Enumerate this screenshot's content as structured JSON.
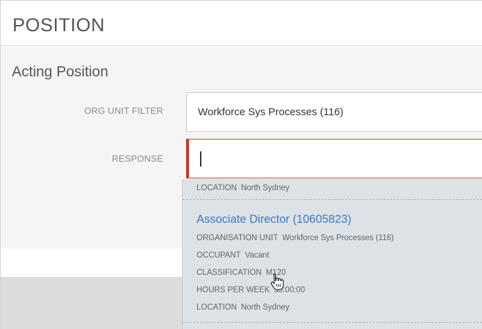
{
  "header": {
    "title": "POSITION"
  },
  "section": {
    "title": "Acting Position"
  },
  "fields": {
    "org_unit_filter": {
      "label": "ORG UNIT FILTER",
      "value": "Workforce Sys Processes (116)"
    },
    "response": {
      "label": "RESPONSE",
      "value": ""
    }
  },
  "dropdown": {
    "previous_option": {
      "location_key": "LOCATION",
      "location_value": "North Sydney"
    },
    "option": {
      "title": "Associate Director (10605823)",
      "details": [
        {
          "key": "ORGANISATION UNIT",
          "value": "Workforce Sys Processes (116)"
        },
        {
          "key": "OCCUPANT",
          "value": "Vacant"
        },
        {
          "key": "CLASSIFICATION",
          "value": "M120"
        },
        {
          "key": "HOURS PER WEEK",
          "value": "35:00:00"
        },
        {
          "key": "LOCATION",
          "value": "North Sydney"
        }
      ]
    }
  },
  "cursor": {
    "icon": "hand-pointer-icon"
  },
  "colors": {
    "accent_error": "#c0391b",
    "link": "#3e7bbf",
    "dropdown_bg": "#dce2e6"
  }
}
